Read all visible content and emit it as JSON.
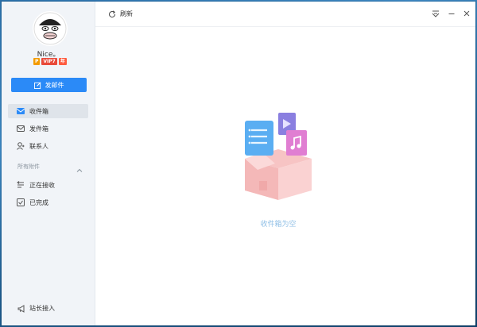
{
  "user": {
    "name": "Nice。",
    "badges": [
      "P",
      "VIP7",
      "年"
    ]
  },
  "sidebar": {
    "compose_label": "发邮件",
    "items": [
      {
        "label": "收件箱"
      },
      {
        "label": "发件箱"
      },
      {
        "label": "联系人"
      }
    ],
    "section_label": "所有附件",
    "attachment_items": [
      {
        "label": "正在接收"
      },
      {
        "label": "已完成"
      }
    ],
    "bottom_label": "站长接入"
  },
  "toolbar": {
    "refresh_label": "刷新"
  },
  "main": {
    "empty_text": "收件箱为空"
  },
  "colors": {
    "accent": "#2b8af7",
    "sidebar_bg": "#f1f4f8",
    "active_bg": "#dfe4ea"
  }
}
